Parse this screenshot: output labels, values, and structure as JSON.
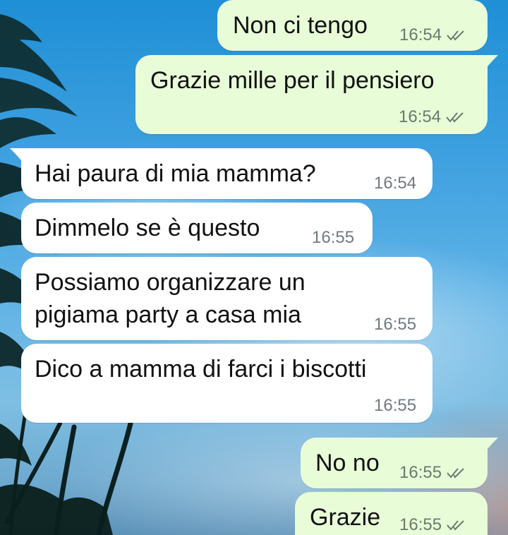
{
  "conversation": {
    "messages": [
      {
        "direction": "out",
        "text": "Non ci tengo",
        "time": "16:54",
        "status": "read"
      },
      {
        "direction": "out",
        "text": "Grazie mille per il pensiero",
        "time": "16:54",
        "status": "read"
      },
      {
        "direction": "in",
        "text": "Hai paura di mia mamma?",
        "time": "16:54"
      },
      {
        "direction": "in",
        "text": "Dimmelo se è questo",
        "time": "16:55"
      },
      {
        "direction": "in",
        "text_line1": "Possiamo organizzare un",
        "text_line2": "pigiama party a casa mia",
        "time": "16:55"
      },
      {
        "direction": "in",
        "text": "Dico a mamma di farci i biscotti",
        "time": "16:55"
      },
      {
        "direction": "out",
        "text": "No no",
        "time": "16:55",
        "status": "read"
      },
      {
        "direction": "out",
        "text": "Grazie",
        "time": "16:55",
        "status": "read"
      }
    ]
  },
  "colors": {
    "outgoing_bubble": "#e8fcd8",
    "incoming_bubble": "#ffffff",
    "read_tick": "#6b7a6b"
  },
  "icons": {
    "read_receipt": "double-check-icon"
  }
}
